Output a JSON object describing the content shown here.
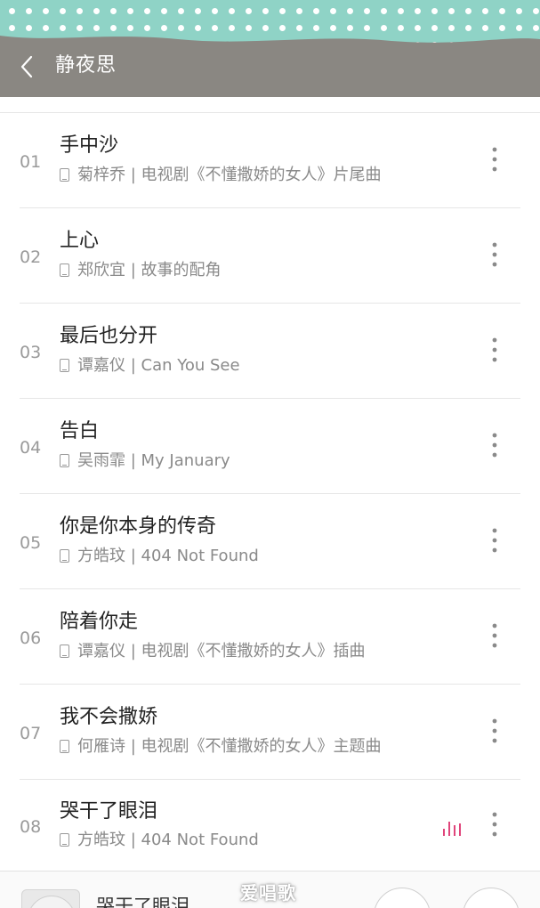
{
  "header": {
    "title": "静夜思",
    "back_icon": "chevron-left-icon",
    "pattern_color": "#8fd3c6",
    "bar_color": "#8a8782"
  },
  "songs": [
    {
      "num": "01",
      "title": "手中沙",
      "meta": "菊梓乔 | 电视剧《不懂撒娇的女人》片尾曲"
    },
    {
      "num": "02",
      "title": "上心",
      "meta": "郑欣宜 | 故事的配角"
    },
    {
      "num": "03",
      "title": "最后也分开",
      "meta": "谭嘉仪 | Can You See"
    },
    {
      "num": "04",
      "title": "告白",
      "meta": "吴雨霏 | My January"
    },
    {
      "num": "05",
      "title": "你是你本身的传奇",
      "meta": "方皓玟 | 404 Not Found"
    },
    {
      "num": "06",
      "title": "陪着你走",
      "meta": "谭嘉仪 | 电视剧《不懂撒娇的女人》插曲"
    },
    {
      "num": "07",
      "title": "我不会撒娇",
      "meta": "何雁诗 | 电视剧《不懂撒娇的女人》主题曲"
    },
    {
      "num": "08",
      "title": "哭干了眼泪",
      "meta": "方皓玟 | 404 Not Found",
      "playing": true
    }
  ],
  "icons": {
    "more": "more-vertical-icon",
    "local": "phone-icon",
    "playing": "equalizer-icon"
  },
  "player": {
    "title": "哭干了眼泪",
    "watermark": "爱唱歌",
    "accent": "#e0457b"
  }
}
